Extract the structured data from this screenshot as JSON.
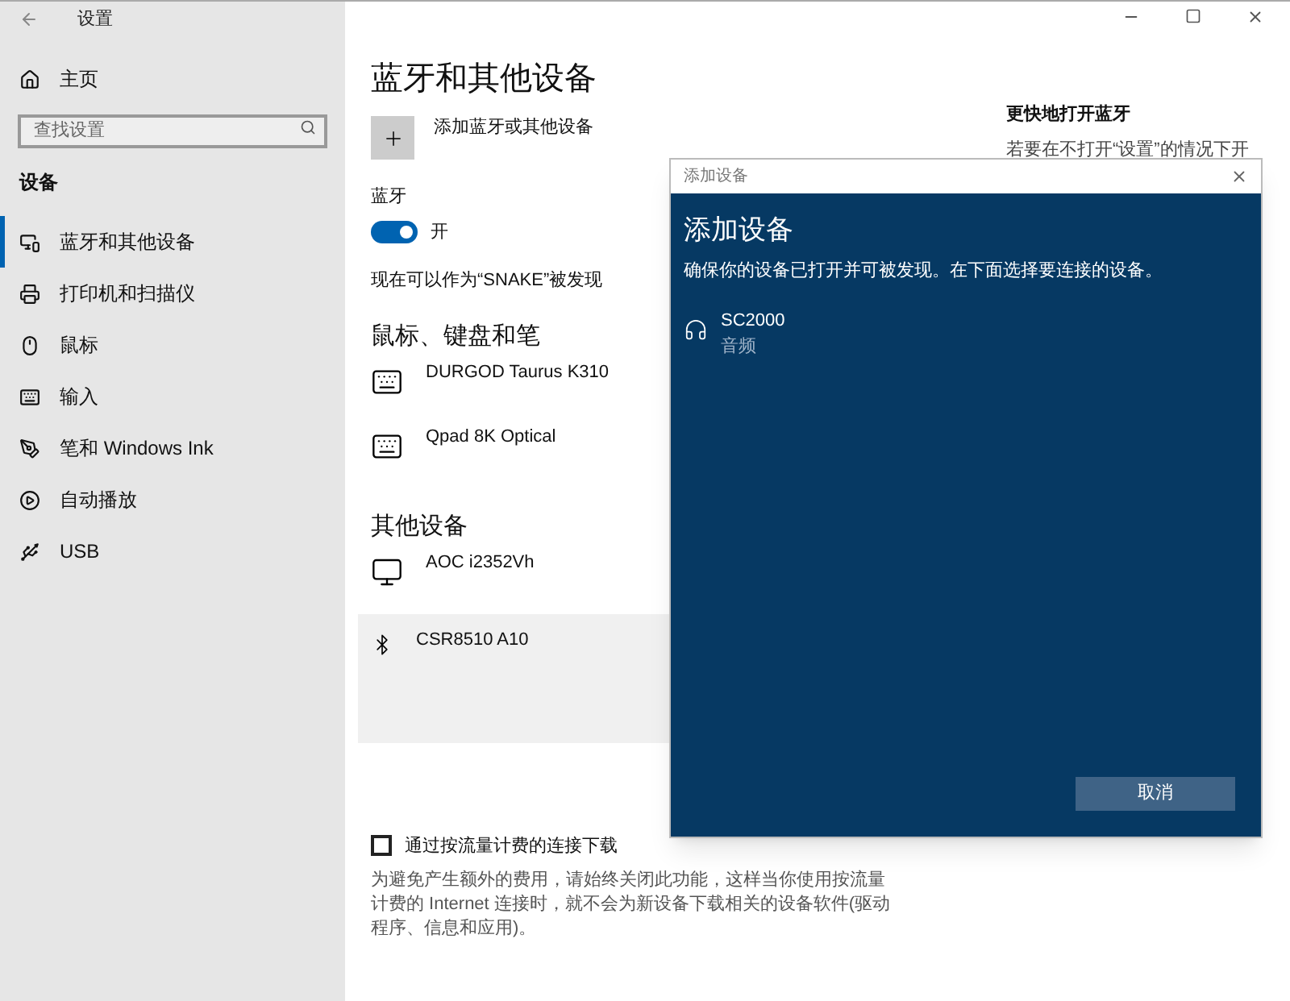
{
  "window": {
    "title": "设置"
  },
  "sidebar": {
    "home": "主页",
    "search": {
      "placeholder": "查找设置"
    },
    "section": "设备",
    "items": [
      {
        "label": "蓝牙和其他设备",
        "kind": "devices",
        "selected": true
      },
      {
        "label": "打印机和扫描仪",
        "kind": "printer",
        "selected": false
      },
      {
        "label": "鼠标",
        "kind": "mouse",
        "selected": false
      },
      {
        "label": "输入",
        "kind": "keyboard",
        "selected": false
      },
      {
        "label": "笔和 Windows Ink",
        "kind": "pen",
        "selected": false
      },
      {
        "label": "自动播放",
        "kind": "autoplay",
        "selected": false
      },
      {
        "label": "USB",
        "kind": "usb",
        "selected": false
      }
    ]
  },
  "main": {
    "title": "蓝牙和其他设备",
    "add_button": "添加蓝牙或其他设备",
    "bluetooth_label": "蓝牙",
    "bluetooth": {
      "on": true,
      "state_label": "开"
    },
    "discoverable": "现在可以作为“SNAKE”被发现",
    "groups": [
      {
        "title": "鼠标、键盘和笔",
        "devices": [
          {
            "name": "DURGOD Taurus K310",
            "kind": "keyboard",
            "selected": false
          },
          {
            "name": "Qpad 8K Optical",
            "kind": "keyboard",
            "selected": false
          }
        ]
      },
      {
        "title": "其他设备",
        "devices": [
          {
            "name": "AOC i2352Vh",
            "kind": "monitor",
            "selected": false
          },
          {
            "name": "CSR8510 A10",
            "kind": "bluetooth",
            "selected": true
          }
        ]
      }
    ],
    "metered": {
      "label": "通过按流量计费的连接下载",
      "checked": false,
      "lines": [
        "为避免产生额外的费用，请始终关闭此功能，这样当你使用按流量",
        "计费的 Internet 连接时，就不会为新设备下载相关的设备软件(驱动",
        "程序、信息和应用)。"
      ]
    }
  },
  "side_panel": {
    "title": "更快地打开蓝牙",
    "text": "若要在不打开“设置”的情况下开"
  },
  "dialog": {
    "title": "添加设备",
    "heading": "添加设备",
    "instructions": "确保你的设备已打开并可被发现。在下面选择要连接的设备。",
    "devices": [
      {
        "name": "SC2000",
        "type": "音频",
        "kind": "headset"
      }
    ],
    "cancel": "取消"
  }
}
